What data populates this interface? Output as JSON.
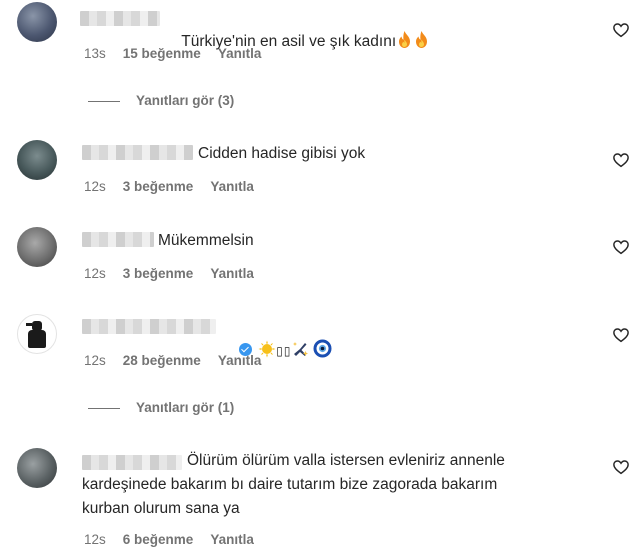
{
  "comments": [
    {
      "text": "Türkiye'nin en asil ve şık kadını",
      "emoji": [
        "fire",
        "fire"
      ],
      "time": "13s",
      "likes": "15 beğenme",
      "reply": "Yanıtla",
      "view_replies": "Yanıtları gör (3)"
    },
    {
      "text": "Cidden hadise gibisi yok",
      "time": "12s",
      "likes": "3 beğenme",
      "reply": "Yanıtla"
    },
    {
      "text": "Mükemmelsin",
      "time": "12s",
      "likes": "3 beğenme",
      "reply": "Yanıtla"
    },
    {
      "text": "▯▯",
      "emoji": [
        "sun",
        "sparkle-plane",
        "nazar"
      ],
      "verified": true,
      "time": "12s",
      "likes": "28 beğenme",
      "reply": "Yanıtla",
      "view_replies": "Yanıtları gör (1)"
    },
    {
      "text_line1": "Ölürüm ölürüm valla istersen evleniriz annenle",
      "text_line2": "kardeşinede bakarım bı daire tutarım bize zagorada bakarım",
      "text_line3": "kurban olurum sana ya",
      "time": "12s",
      "likes": "6 beğenme",
      "reply": "Yanıtla"
    }
  ],
  "icons": {
    "like": "heart-outline-icon",
    "fire": "fire-emoji",
    "verified": "verified-badge-icon"
  },
  "colors": {
    "meta": "#737373",
    "text": "#262626",
    "verified": "#3897f0"
  }
}
